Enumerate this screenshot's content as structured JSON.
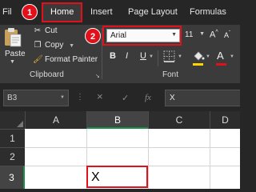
{
  "tabs": [
    {
      "label": "Fil"
    },
    {
      "label": "Home",
      "selected": true
    },
    {
      "label": "Insert"
    },
    {
      "label": "Page Layout"
    },
    {
      "label": "Formulas"
    }
  ],
  "callouts": [
    "1",
    "2"
  ],
  "clipboard": {
    "paste_label": "Paste",
    "cut_label": "Cut",
    "copy_label": "Copy",
    "format_painter_label": "Format Painter",
    "group_label": "Clipboard"
  },
  "font": {
    "name": "Arial",
    "size": "11",
    "grow_label": "A",
    "shrink_label": "A",
    "bold_label": "B",
    "italic_label": "I",
    "underline_label": "U",
    "color_label": "A",
    "group_label": "Font",
    "highlight_color": "#ffd400",
    "font_color": "#e0111b"
  },
  "formula_bar": {
    "name_box": "B3",
    "cancel_icon": "×",
    "enter_icon": "✓",
    "fx_label": "fx",
    "value": "X"
  },
  "grid": {
    "columns": [
      "A",
      "B",
      "C",
      "D"
    ],
    "rows": [
      "1",
      "2",
      "3"
    ],
    "selected_cell": "B3",
    "cells": {
      "B3": "X"
    }
  },
  "colors": {
    "accent_red": "#e0111b",
    "selection_green": "#1e8c4a"
  }
}
